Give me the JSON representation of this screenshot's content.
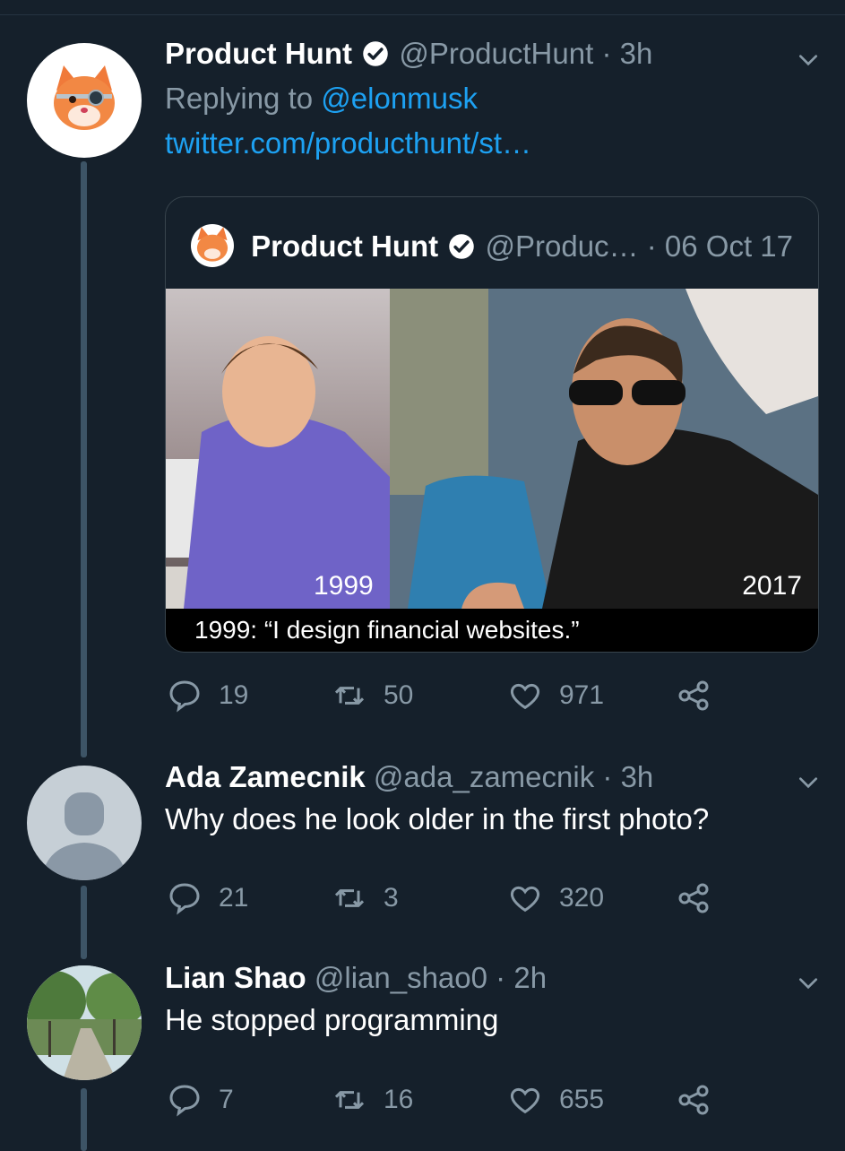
{
  "tweets": [
    {
      "name": "Product Hunt",
      "handle": "@ProductHunt",
      "dot": "·",
      "time": "3h",
      "reply_prefix": "Replying to",
      "reply_to": "@elonmusk",
      "link": "twitter.com/producthunt/st…",
      "quote": {
        "name": "Product Hunt",
        "handle": "@Produc…",
        "dot": "·",
        "date": "06 Oct 17",
        "image_label_left": "1999",
        "image_label_right": "2017",
        "caption": "1999: “I design financial websites.”"
      },
      "actions": {
        "replies": "19",
        "retweets": "50",
        "likes": "971"
      },
      "avatar_icon": "cat-logo-icon"
    },
    {
      "name": "Ada Zamecnik",
      "handle": "@ada_zamecnik",
      "dot": "·",
      "time": "3h",
      "text": "Why does he look older in the first photo?",
      "actions": {
        "replies": "21",
        "retweets": "3",
        "likes": "320"
      },
      "avatar_icon": "default-profile-icon"
    },
    {
      "name": "Lian Shao",
      "handle": "@lian_shao0",
      "dot": "·",
      "time": "2h",
      "text": "He stopped programming",
      "actions": {
        "replies": "7",
        "retweets": "16",
        "likes": "655"
      },
      "avatar_icon": "profile-photo"
    }
  ],
  "colors": {
    "background": "#15202b",
    "secondary_text": "#8899a6",
    "link": "#1da1f2",
    "thread_line": "#3d5466"
  }
}
